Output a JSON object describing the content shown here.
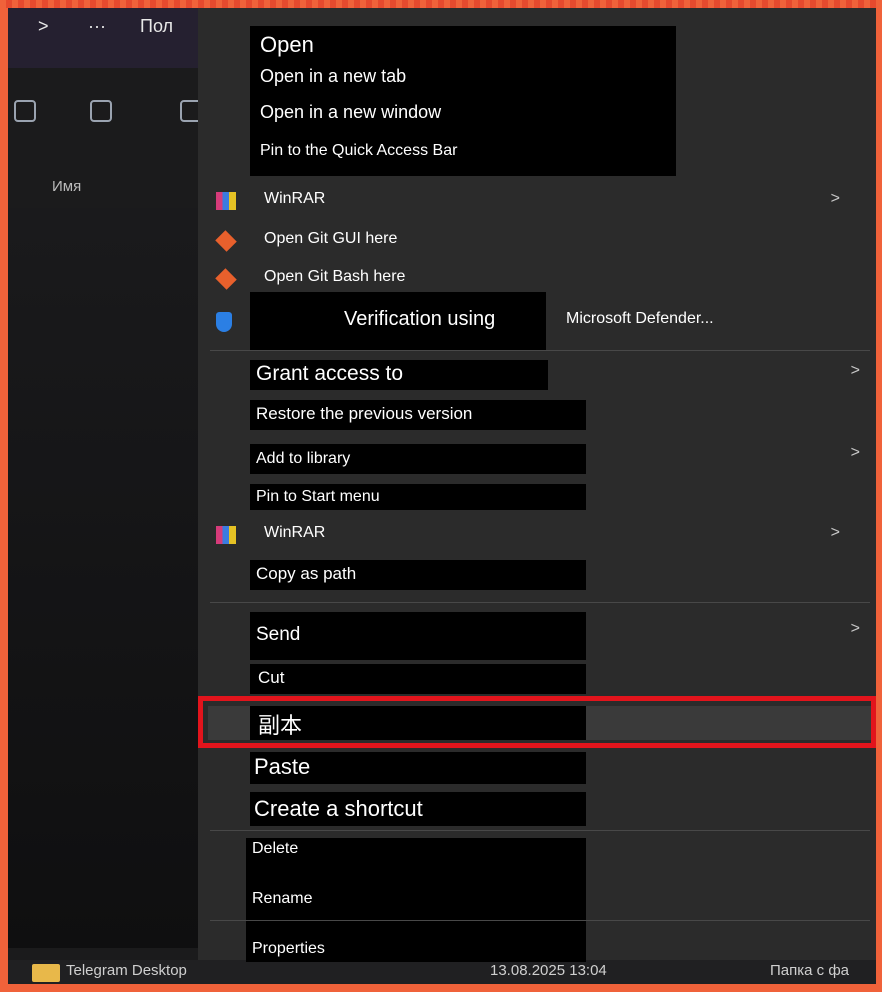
{
  "explorer": {
    "breadcrumb_arrow": ">",
    "breadcrumb_more": "···",
    "breadcrumb_partial": "Пол",
    "column_name": "Имя",
    "bottom_file_name": "Telegram Desktop",
    "bottom_file_date": "13.08.2025 13:04",
    "bottom_file_type": "Папка с фа"
  },
  "menu": {
    "open": "Open",
    "open_new_tab": "Open in a new tab",
    "open_new_window": "Open in a new window",
    "pin_quick_access": "Pin to the Quick Access Bar",
    "winrar_1": "WinRAR",
    "git_gui": "Open Git GUI here",
    "git_bash": "Open Git Bash here",
    "verification_label": "Verification using",
    "defender_suffix": "Microsoft Defender...",
    "grant_access": "Grant access to",
    "restore_previous": "Restore the previous version",
    "add_library": "Add to library",
    "pin_start": "Pin to Start menu",
    "winrar_2": "WinRAR",
    "copy_path": "Copy as path",
    "send": "Send",
    "cut": "Cut",
    "copy": "副本",
    "paste": "Paste",
    "create_shortcut": "Create a shortcut",
    "delete": "Delete",
    "rename": "Rename",
    "properties": "Properties",
    "submenu_chevron": ">"
  },
  "colors": {
    "border": "#f0623a",
    "highlight": "#e2141c",
    "menu_bg": "#2b2b2b"
  }
}
